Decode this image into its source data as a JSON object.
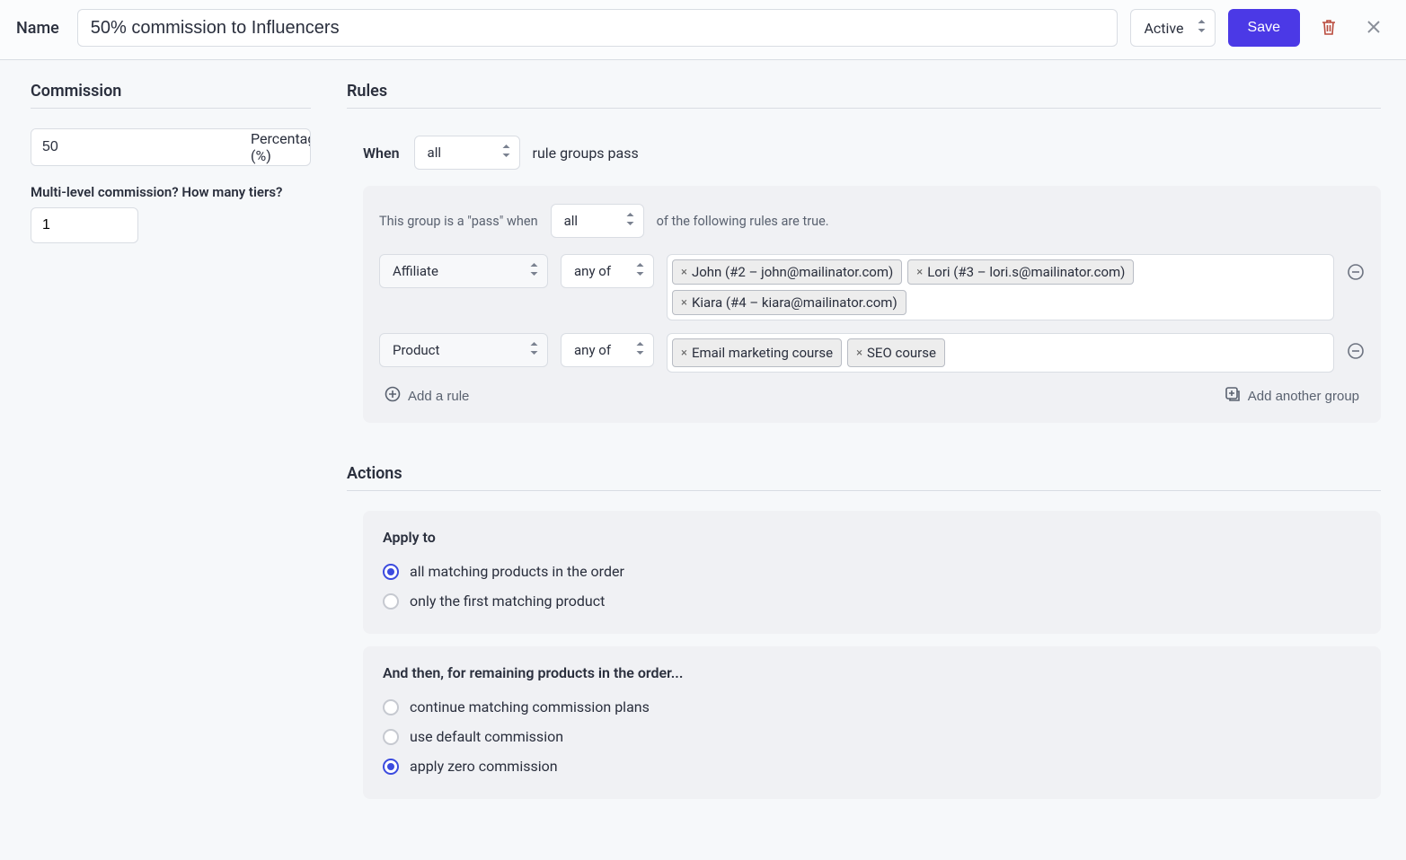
{
  "header": {
    "name_label": "Name",
    "name_value": "50% commission to Influencers",
    "status_selected": "Active",
    "save_label": "Save"
  },
  "commission": {
    "heading": "Commission",
    "value": "50",
    "unit_label": "Percentage (%)",
    "tiers_label": "Multi-level commission? How many tiers?",
    "tiers_value": "1"
  },
  "rules": {
    "heading": "Rules",
    "when_label": "When",
    "when_selected": "all",
    "when_suffix": "rule groups pass",
    "group": {
      "prefix": "This group is a \"pass\" when",
      "selected": "all",
      "suffix": "of the following rules are true.",
      "rows": [
        {
          "field": "Affiliate",
          "op": "any of",
          "chips": [
            "John (#2 – john@mailinator.com)",
            "Lori (#3 – lori.s@mailinator.com)",
            "Kiara (#4 – kiara@mailinator.com)"
          ]
        },
        {
          "field": "Product",
          "op": "any of",
          "chips": [
            "Email marketing course",
            "SEO course"
          ]
        }
      ],
      "add_rule_label": "Add a rule",
      "add_group_label": "Add another group"
    }
  },
  "actions": {
    "heading": "Actions",
    "apply_to": {
      "heading": "Apply to",
      "options": [
        {
          "label": "all matching products in the order",
          "selected": true
        },
        {
          "label": "only the first matching product",
          "selected": false
        }
      ]
    },
    "remaining": {
      "heading": "And then, for remaining products in the order...",
      "options": [
        {
          "label": "continue matching commission plans",
          "selected": false
        },
        {
          "label": "use default commission",
          "selected": false
        },
        {
          "label": "apply zero commission",
          "selected": true
        }
      ]
    }
  }
}
